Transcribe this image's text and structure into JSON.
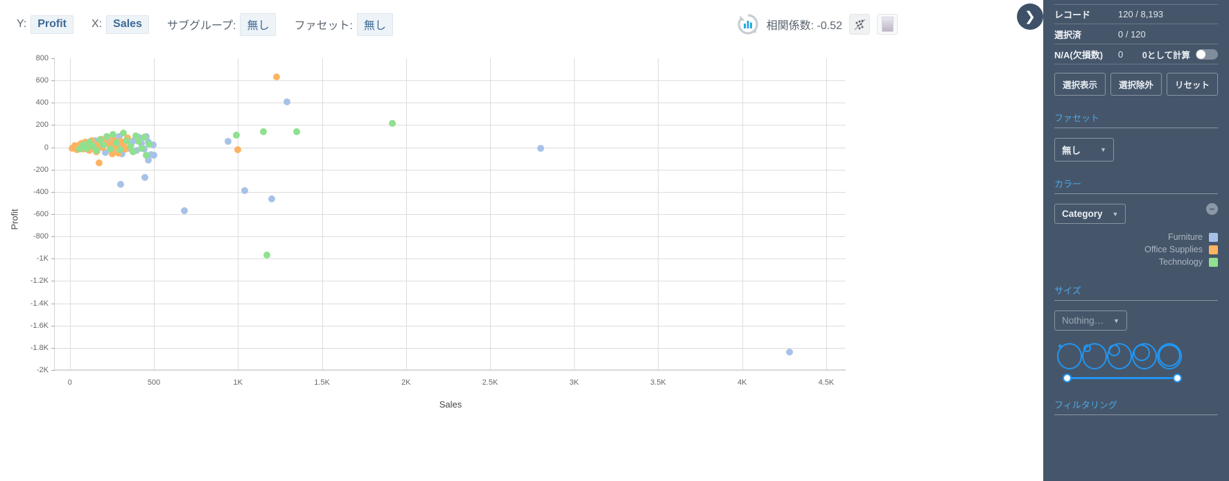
{
  "toolbar": {
    "y_label": "Y:",
    "y_value": "Profit",
    "x_label": "X:",
    "x_value": "Sales",
    "subgroup_label": "サブグループ:",
    "subgroup_value": "無し",
    "facet_label": "ファセット:",
    "facet_value": "無し",
    "correlation_text": "相関係数: -0.52",
    "scatter_mode_icon": "scatter-plot-icon",
    "heatmap_mode_icon": "gradient-square-icon",
    "refresh_icon": "refresh-chart-icon",
    "expand_icon": "chevron-right-icon"
  },
  "sidebar": {
    "stats": [
      {
        "key": "レコード",
        "value": "120 / 8,193"
      },
      {
        "key": "選択済",
        "value": "0 / 120"
      },
      {
        "key": "N/A(欠損数)",
        "value": "0",
        "extra_label": "0として計算",
        "toggle": "off"
      }
    ],
    "buttons": [
      "選択表示",
      "選択除外",
      "リセット"
    ],
    "facet": {
      "title": "ファセット",
      "value": "無し"
    },
    "color": {
      "title": "カラー",
      "value": "Category",
      "remove_icon": "minus-circle-icon",
      "legend": [
        {
          "label": "Furniture",
          "color": "#a7c2e8"
        },
        {
          "label": "Office Supplies",
          "color": "#fcb462"
        },
        {
          "label": "Technology",
          "color": "#8fe08f"
        }
      ]
    },
    "size": {
      "title": "サイズ",
      "value": "Nothing…"
    },
    "filtering": {
      "title": "フィルタリング"
    }
  },
  "chart_data": {
    "type": "scatter",
    "title": "",
    "xlabel": "Sales",
    "ylabel": "Profit",
    "xlim": [
      -90,
      4620
    ],
    "ylim": [
      -2000,
      800
    ],
    "grid": true,
    "xticks": [
      "0",
      "500",
      "1K",
      "1.5K",
      "2K",
      "2.5K",
      "3K",
      "3.5K",
      "4K",
      "4.5K"
    ],
    "xtick_values": [
      0,
      500,
      1000,
      1500,
      2000,
      2500,
      3000,
      3500,
      4000,
      4500
    ],
    "yticks": [
      "800",
      "600",
      "400",
      "200",
      "0",
      "-200",
      "-400",
      "-600",
      "-800",
      "-1K",
      "-1.2K",
      "-1.4K",
      "-1.6K",
      "-1.8K",
      "-2K"
    ],
    "ytick_values": [
      800,
      600,
      400,
      200,
      0,
      -200,
      -400,
      -600,
      -800,
      -1000,
      -1200,
      -1400,
      -1600,
      -1800,
      -2000
    ],
    "legend_position": "right-panel",
    "color_by": "Category",
    "series": [
      {
        "name": "Furniture",
        "color": "#a7c2e8",
        "points": [
          [
            20,
            -5
          ],
          [
            35,
            8
          ],
          [
            48,
            -12
          ],
          [
            60,
            20
          ],
          [
            72,
            -8
          ],
          [
            85,
            30
          ],
          [
            95,
            12
          ],
          [
            110,
            -20
          ],
          [
            120,
            45
          ],
          [
            135,
            5
          ],
          [
            148,
            60
          ],
          [
            160,
            -35
          ],
          [
            172,
            25
          ],
          [
            185,
            70
          ],
          [
            198,
            15
          ],
          [
            210,
            -45
          ],
          [
            225,
            80
          ],
          [
            240,
            30
          ],
          [
            255,
            -15
          ],
          [
            268,
            55
          ],
          [
            282,
            10
          ],
          [
            295,
            95
          ],
          [
            310,
            -60
          ],
          [
            322,
            40
          ],
          [
            338,
            75
          ],
          [
            352,
            -10
          ],
          [
            365,
            20
          ],
          [
            380,
            60
          ],
          [
            395,
            -30
          ],
          [
            410,
            88
          ],
          [
            425,
            35
          ],
          [
            440,
            -18
          ],
          [
            455,
            100
          ],
          [
            468,
            50
          ],
          [
            482,
            -65
          ],
          [
            495,
            25
          ],
          [
            300,
            -330
          ],
          [
            448,
            -270
          ],
          [
            500,
            -70
          ],
          [
            468,
            -115
          ],
          [
            940,
            55
          ],
          [
            1040,
            -390
          ],
          [
            1200,
            -465
          ],
          [
            1290,
            408
          ],
          [
            2800,
            -10
          ],
          [
            680,
            -570
          ],
          [
            4280,
            -1840
          ]
        ]
      },
      {
        "name": "Office Supplies",
        "color": "#fcb462",
        "points": [
          [
            12,
            -8
          ],
          [
            28,
            15
          ],
          [
            42,
            -20
          ],
          [
            55,
            5
          ],
          [
            68,
            35
          ],
          [
            80,
            -12
          ],
          [
            92,
            48
          ],
          [
            105,
            18
          ],
          [
            118,
            -30
          ],
          [
            130,
            62
          ],
          [
            145,
            8
          ],
          [
            158,
            -42
          ],
          [
            170,
            28
          ],
          [
            182,
            75
          ],
          [
            195,
            -5
          ],
          [
            208,
            40
          ],
          [
            222,
            90
          ],
          [
            235,
            22
          ],
          [
            250,
            -25
          ],
          [
            262,
            68
          ],
          [
            275,
            12
          ],
          [
            288,
            -50
          ],
          [
            302,
            55
          ],
          [
            318,
            30
          ],
          [
            332,
            -15
          ],
          [
            345,
            82
          ],
          [
            175,
            -140
          ],
          [
            252,
            -60
          ],
          [
            1000,
            -20
          ],
          [
            1230,
            632
          ]
        ]
      },
      {
        "name": "Technology",
        "color": "#8fe08f",
        "points": [
          [
            58,
            -18
          ],
          [
            78,
            25
          ],
          [
            98,
            -8
          ],
          [
            118,
            48
          ],
          [
            138,
            12
          ],
          [
            158,
            -30
          ],
          [
            178,
            68
          ],
          [
            198,
            20
          ],
          [
            218,
            95
          ],
          [
            238,
            -12
          ],
          [
            258,
            115
          ],
          [
            278,
            42
          ],
          [
            298,
            -22
          ],
          [
            318,
            130
          ],
          [
            338,
            60
          ],
          [
            358,
            10
          ],
          [
            375,
            -40
          ],
          [
            392,
            105
          ],
          [
            408,
            52
          ],
          [
            425,
            -8
          ],
          [
            440,
            88
          ],
          [
            455,
            -72
          ],
          [
            470,
            30
          ],
          [
            990,
            110
          ],
          [
            1150,
            140
          ],
          [
            1350,
            138
          ],
          [
            1920,
            215
          ],
          [
            1170,
            -965
          ]
        ]
      }
    ]
  }
}
